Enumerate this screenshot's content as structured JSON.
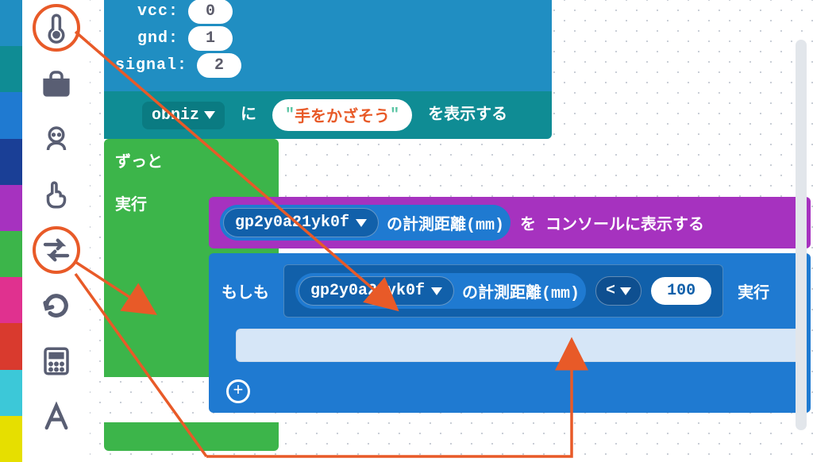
{
  "category_colors": [
    "#208ec2",
    "#0f8c94",
    "#1f7ad1",
    "#1a3f96",
    "#a632bf",
    "#3cb54a",
    "#e0318f",
    "#d93a2e",
    "#3cc8d8",
    "#e6df00"
  ],
  "sidebar_icons": [
    "thermometer",
    "toolbox",
    "robot",
    "pointer-hand",
    "swap-arrows",
    "undo",
    "calculator",
    "text-letter"
  ],
  "sensor_block": {
    "rows": [
      {
        "label": "vcc:",
        "value": "0"
      },
      {
        "label": "gnd:",
        "value": "1"
      },
      {
        "label": "signal:",
        "value": "2"
      }
    ]
  },
  "display_block": {
    "target": "obniz",
    "particle1": "に",
    "quote": "\"",
    "text": "手をかざそう",
    "particle2": "を表示する"
  },
  "forever": {
    "title": "ずっと",
    "run": "実行"
  },
  "console_block": {
    "sensor": "gp2y0a21yk0f",
    "metric": "の計測距離(mm)",
    "particle": "を",
    "action": "コンソールに表示する"
  },
  "if_block": {
    "keyword": "もしも",
    "sensor": "gp2y0a21yk0f",
    "metric": "の計測距離(mm)",
    "op": "<",
    "value": "100",
    "run": "実行"
  }
}
